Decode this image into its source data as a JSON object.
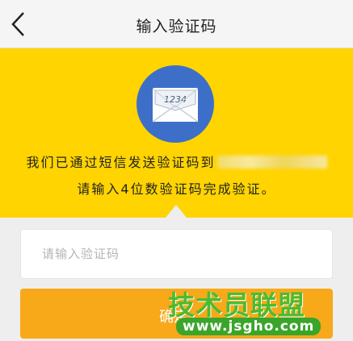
{
  "header": {
    "title": "输入验证码",
    "back_icon": "chevron-left-icon"
  },
  "banner": {
    "icon": "envelope-icon",
    "envelope_code": "1234",
    "message_line1": "我们已通过短信发送验证码到",
    "message_line2": "请输入4位数验证码完成验证。",
    "background_color": "#ffd400",
    "circle_color": "#3d6fc9"
  },
  "form": {
    "code_placeholder": "请输入验证码",
    "code_value": "",
    "confirm_label": "确定",
    "button_color": "#f7a91a"
  },
  "watermark": {
    "name": "技术员联盟",
    "url": "www.jsgho.com"
  }
}
